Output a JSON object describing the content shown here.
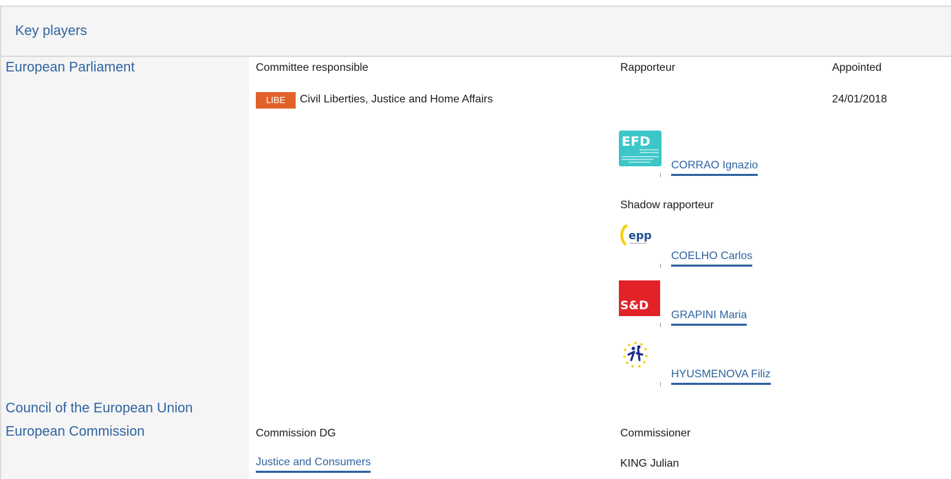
{
  "section": {
    "title": "Key players"
  },
  "institutions": {
    "parliament": "European Parliament",
    "council": "Council of the European Union",
    "commission": "European Commission"
  },
  "parliament_table": {
    "headers": {
      "committee": "Committee responsible",
      "rapporteur": "Rapporteur",
      "appointed": "Appointed"
    },
    "committee_code": "LIBE",
    "committee_name": "Civil Liberties, Justice and Home Affairs",
    "appointed_date": "24/01/2018",
    "rapporteur": {
      "name": "CORRAO Ignazio",
      "group_logo": "EFD"
    },
    "shadow_label": "Shadow rapporteur",
    "shadows": [
      {
        "name": "COELHO Carlos",
        "group_logo": "epp"
      },
      {
        "name": "GRAPINI Maria",
        "group_logo": "S&D"
      },
      {
        "name": "HYUSMENOVA Filiz",
        "group_logo": "alde-stars"
      }
    ]
  },
  "commission_table": {
    "headers": {
      "dg": "Commission DG",
      "commissioner": "Commissioner"
    },
    "dg": "Justice and Consumers",
    "commissioner": "KING Julian"
  },
  "colors": {
    "link": "#2e63a0",
    "badge": "#e0622a",
    "band": "#f5f5f5",
    "efd": "#3cc6c8",
    "sd": "#e32228",
    "epp_yellow": "#f5d000",
    "epp_blue": "#1d4f91"
  }
}
